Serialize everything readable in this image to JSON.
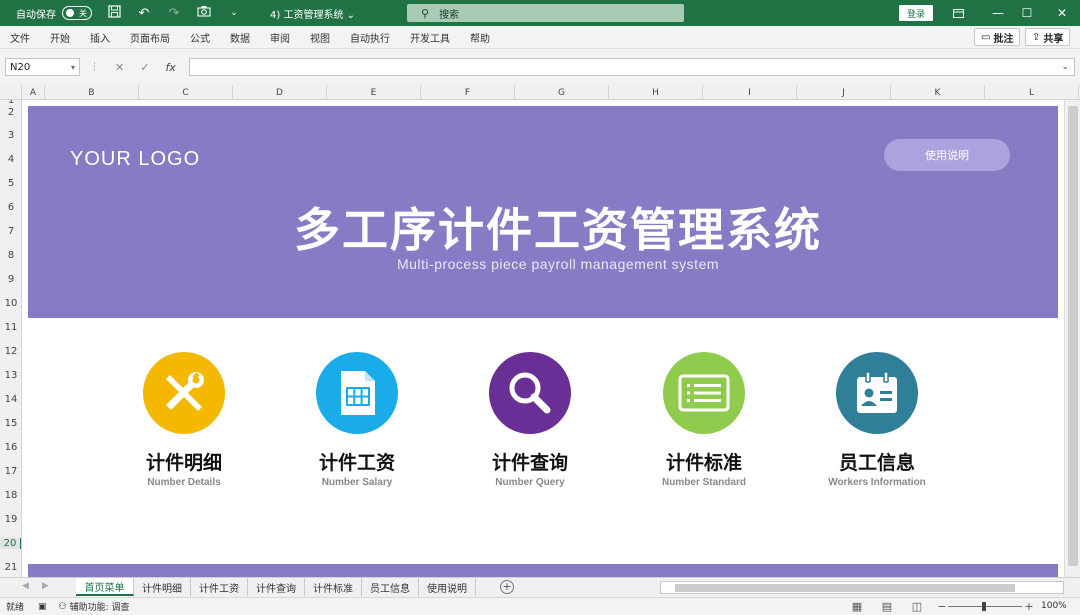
{
  "titlebar": {
    "autosave_label": "自动保存",
    "autosave_state": "关",
    "doc_title": "4) 工资管理系统 ⌄",
    "search_placeholder": "搜索",
    "login_label": "登录",
    "icons": [
      "save-icon",
      "undo-icon",
      "redo-icon",
      "camera-icon",
      "customize-icon"
    ]
  },
  "menu": {
    "items": [
      "文件",
      "开始",
      "插入",
      "页面布局",
      "公式",
      "数据",
      "审阅",
      "视图",
      "自动执行",
      "开发工具",
      "帮助"
    ],
    "comment_label": "批注",
    "share_label": "共享"
  },
  "formula": {
    "name_box": "N20",
    "fx": "fx",
    "content": ""
  },
  "grid": {
    "columns": [
      "A",
      "B",
      "C",
      "D",
      "E",
      "F",
      "G",
      "H",
      "I",
      "J",
      "K",
      "L"
    ],
    "rows": [
      "1",
      "2",
      "3",
      "4",
      "5",
      "6",
      "7",
      "8",
      "9",
      "10",
      "11",
      "12",
      "13",
      "14",
      "15",
      "16",
      "17",
      "18",
      "19",
      "20",
      "21"
    ],
    "selected_row": "20"
  },
  "banner": {
    "logo": "YOUR LOGO",
    "help_button": "使用说明",
    "title": "多工序计件工资管理系统",
    "subtitle": "Multi-process piece payroll management system",
    "color": "#887bc6"
  },
  "modules": [
    {
      "title": "计件明细",
      "subtitle": "Number Details",
      "icon": "tools-icon",
      "color": "#f5b800"
    },
    {
      "title": "计件工资",
      "subtitle": "Number Salary",
      "icon": "spreadsheet-doc-icon",
      "color": "#1aace8"
    },
    {
      "title": "计件查询",
      "subtitle": "Number Query",
      "icon": "search-icon",
      "color": "#6a2f96"
    },
    {
      "title": "计件标准",
      "subtitle": "Number Standard",
      "icon": "list-doc-icon",
      "color": "#8fcc4e"
    },
    {
      "title": "员工信息",
      "subtitle": "Workers Information",
      "icon": "contact-card-icon",
      "color": "#2f7f99"
    }
  ],
  "sheet_tabs": [
    "首页菜单",
    "计件明细",
    "计件工资",
    "计件查询",
    "计件标准",
    "员工信息",
    "使用说明"
  ],
  "active_tab": "首页菜单",
  "status": {
    "ready": "就绪",
    "accessibility": "辅助功能: 调查",
    "zoom": "100%"
  }
}
